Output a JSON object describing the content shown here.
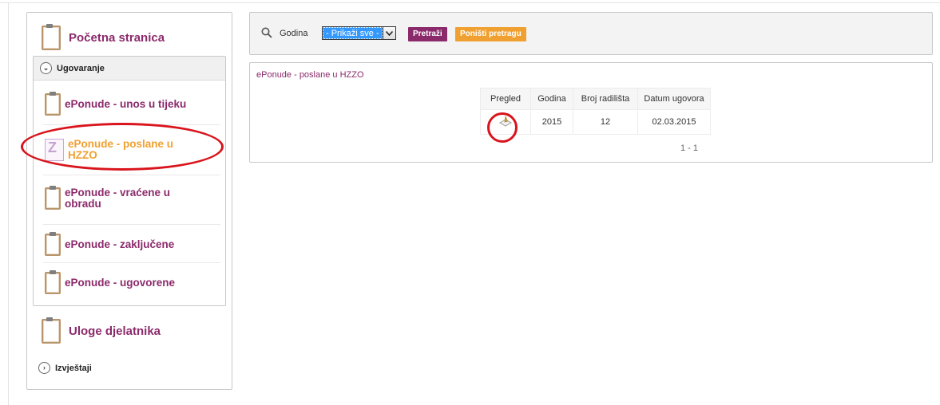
{
  "sidebar": {
    "home_label": "Početna stranica",
    "group_label": "Ugovaranje",
    "items": [
      {
        "label": "ePonude - unos u tijeku"
      },
      {
        "label": "ePonude - poslane u HZZO"
      },
      {
        "label": "ePonude - vraćene u obradu"
      },
      {
        "label": "ePonude - zaključene"
      },
      {
        "label": "ePonude - ugovorene"
      }
    ],
    "roles_label": "Uloge djelatnika",
    "reports_label": "Izvještaji"
  },
  "search": {
    "label": "Godina",
    "selected": "- Prikaži sve -",
    "search_button": "Pretraži",
    "reset_button": "Poništi pretragu"
  },
  "results": {
    "title": "ePonude - poslane u HZZO",
    "columns": [
      "Pregled",
      "Godina",
      "Broj radilišta",
      "Datum ugovora"
    ],
    "rows": [
      {
        "godina": "2015",
        "broj_radilista": "12",
        "datum": "02.03.2015"
      }
    ],
    "pager": "1 - 1"
  },
  "colors": {
    "brand": "#8b2a6b",
    "accent": "#f0a030",
    "highlight": "#d9141c"
  }
}
